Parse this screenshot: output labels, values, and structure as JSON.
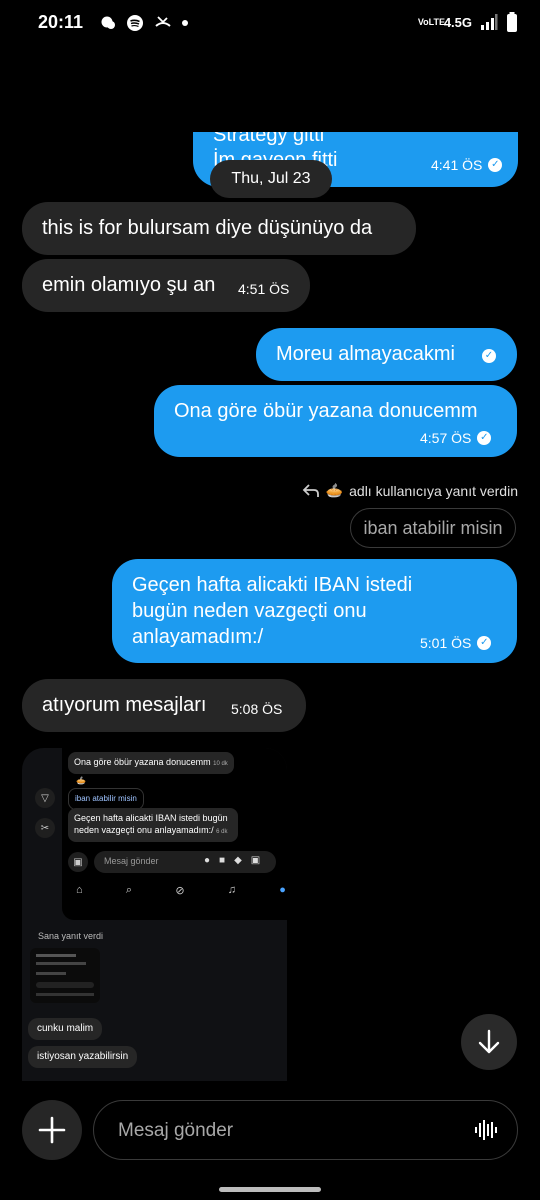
{
  "status_bar": {
    "time": "20:11",
    "network": "4.5G",
    "volte": "VoLTE"
  },
  "header": {
    "contact_emoji": "🥧",
    "icons": [
      "back-arrow-icon",
      "phone-icon",
      "video-icon",
      "more-icon"
    ]
  },
  "messages": {
    "top_partial": {
      "line1": "Strategy gitti",
      "line2": "İm gayeon fitti",
      "time": "4:41 ÖS"
    },
    "date_separator": "Thu, Jul 23",
    "m1": {
      "text": "this is for bulursam diye düşünüyo da"
    },
    "m2": {
      "text": "emin olamıyo şu an",
      "time": "4:51 ÖS"
    },
    "m3": {
      "text": "Moreu almayacakmi"
    },
    "m4": {
      "text": "Ona göre öbür yazana donucemm",
      "time": "4:57 ÖS"
    },
    "reply_note": {
      "emoji": "🥧",
      "text": "adlı kullanıcıya yanıt verdin"
    },
    "reply_quote": "iban atabilir misin",
    "m5": {
      "line1": "Geçen hafta alicakti IBAN istedi",
      "line2": "bugün neden vazgeçti onu",
      "line3": "anlayamadım:/",
      "time": "5:01 ÖS"
    },
    "m6": {
      "text": "atıyorum mesajları",
      "time": "5:08 ÖS"
    }
  },
  "shared_screenshot": {
    "b1": "Ona göre öbür yazana donucemm",
    "b1_time": "10 dk",
    "b2": "iban atabilir misin",
    "b3_line1": "Geçen hafta alicakti IBAN istedi bugün",
    "b3_line2": "neden vazgeçti onu anlayamadım:/",
    "b3_time": "6 dk",
    "composer_placeholder": "Mesaj gönder",
    "replied_label": "Sana yanıt verdi",
    "b4": "cunku malim",
    "b5": "istiyosan yazabilirsin"
  },
  "composer": {
    "placeholder": "Mesaj gönder"
  }
}
